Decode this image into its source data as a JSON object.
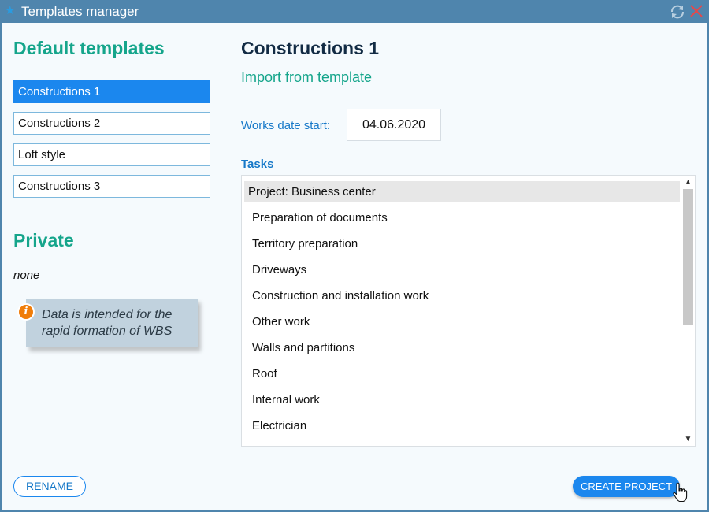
{
  "window": {
    "title": "Templates manager",
    "title_icon": "star-icon",
    "controls": [
      "refresh-icon",
      "close-icon"
    ]
  },
  "sidebar": {
    "default_heading": "Default templates",
    "templates": [
      {
        "label": "Constructions 1",
        "selected": true
      },
      {
        "label": "Constructions 2",
        "selected": false
      },
      {
        "label": "Loft style",
        "selected": false
      },
      {
        "label": "Constructions 3",
        "selected": false
      }
    ],
    "private_heading": "Private",
    "private_value": "none",
    "info_text": "Data is intended for the rapid formation of WBS",
    "info_icon": "info-icon"
  },
  "main": {
    "project_title": "Constructions 1",
    "import_heading": "Import from template",
    "date_label": "Works date start:",
    "date_value": "04.06.2020",
    "tasks_label": "Tasks",
    "tasks": [
      "Project: Business center",
      "Preparation of documents",
      "Territory preparation",
      "Driveways",
      "Construction and installation work",
      "Other work",
      "Walls and partitions",
      "Roof",
      "Internal work",
      "Electrician"
    ]
  },
  "footer": {
    "rename_label": "RENAME",
    "create_label": "CREATE PROJECT"
  },
  "colors": {
    "titlebar": "#4f85ad",
    "accent_green": "#15a58b",
    "accent_blue": "#1b87ee",
    "info_orange": "#f07d0a"
  }
}
